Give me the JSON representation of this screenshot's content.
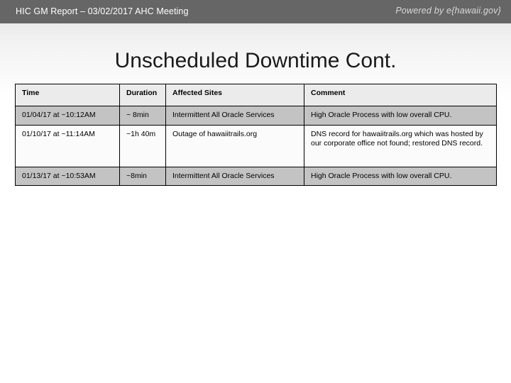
{
  "header": {
    "title": "HIC GM Report – 03/02/2017 AHC Meeting",
    "logo": "Powered by e{hawaii.gov}",
    "bar_color": "#666666"
  },
  "slide": {
    "title": "Unscheduled Downtime Cont."
  },
  "table": {
    "columns": [
      "Time",
      "Duration",
      "Affected Sites",
      "Comment"
    ],
    "rows": [
      {
        "time": "01/04/17 at ~10:12AM",
        "duration": "~ 8min",
        "sites": "Intermittent All Oracle Services",
        "comment": "High Oracle Process with low overall CPU."
      },
      {
        "time": "01/10/17 at ~11:14AM",
        "duration": "~1h 40m",
        "sites": "Outage of hawaiitrails.org",
        "comment": "DNS record for hawaiitrails.org which was hosted by our corporate office not found; restored DNS record."
      },
      {
        "time": "01/13/17 at ~10:53AM",
        "duration": "~8min",
        "sites": "Intermittent All Oracle Services",
        "comment": "High Oracle Process with low overall CPU."
      }
    ],
    "shade_color": "#c3c3c3",
    "header_color": "#ebebeb"
  }
}
